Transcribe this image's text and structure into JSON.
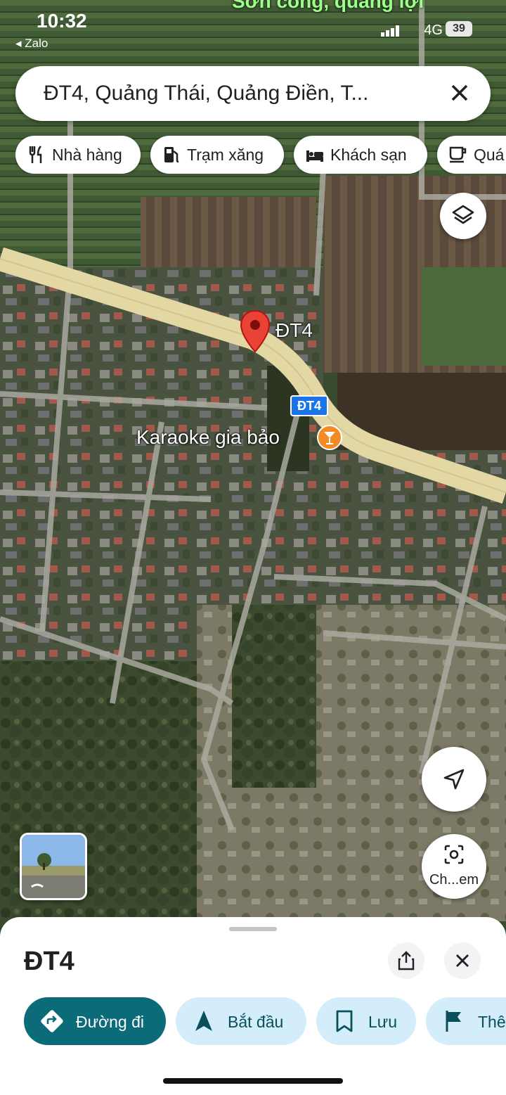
{
  "status_bar": {
    "time": "10:32",
    "back_app": "◂ Zalo",
    "network": "4G",
    "battery": "39"
  },
  "map": {
    "top_label": "Sơn công, quảng lợi",
    "pin_label": "ĐT4",
    "road_shield": "ĐT4",
    "poi_label": "Karaoke gia bảo"
  },
  "search": {
    "value": "ĐT4, Quảng Thái, Quảng Điền, T..."
  },
  "chips": [
    {
      "label": "Nhà hàng",
      "icon": "restaurant-icon"
    },
    {
      "label": "Trạm xăng",
      "icon": "gas-station-icon"
    },
    {
      "label": "Khách sạn",
      "icon": "hotel-icon"
    },
    {
      "label": "Quá",
      "icon": "cafe-icon"
    }
  ],
  "camera_button_label": "Ch...em",
  "sheet": {
    "title": "ĐT4",
    "actions": [
      {
        "label": "Đường đi",
        "icon": "directions-icon"
      },
      {
        "label": "Bắt đầu",
        "icon": "navigation-icon"
      },
      {
        "label": "Lưu",
        "icon": "bookmark-icon"
      },
      {
        "label": "Thê",
        "icon": "flag-icon"
      }
    ]
  },
  "colors": {
    "primary_action": "#0b6b78",
    "secondary_action": "#d3edfa",
    "pin": "#ea4335",
    "poi": "#f28b24",
    "road": "#e3d7a4"
  }
}
